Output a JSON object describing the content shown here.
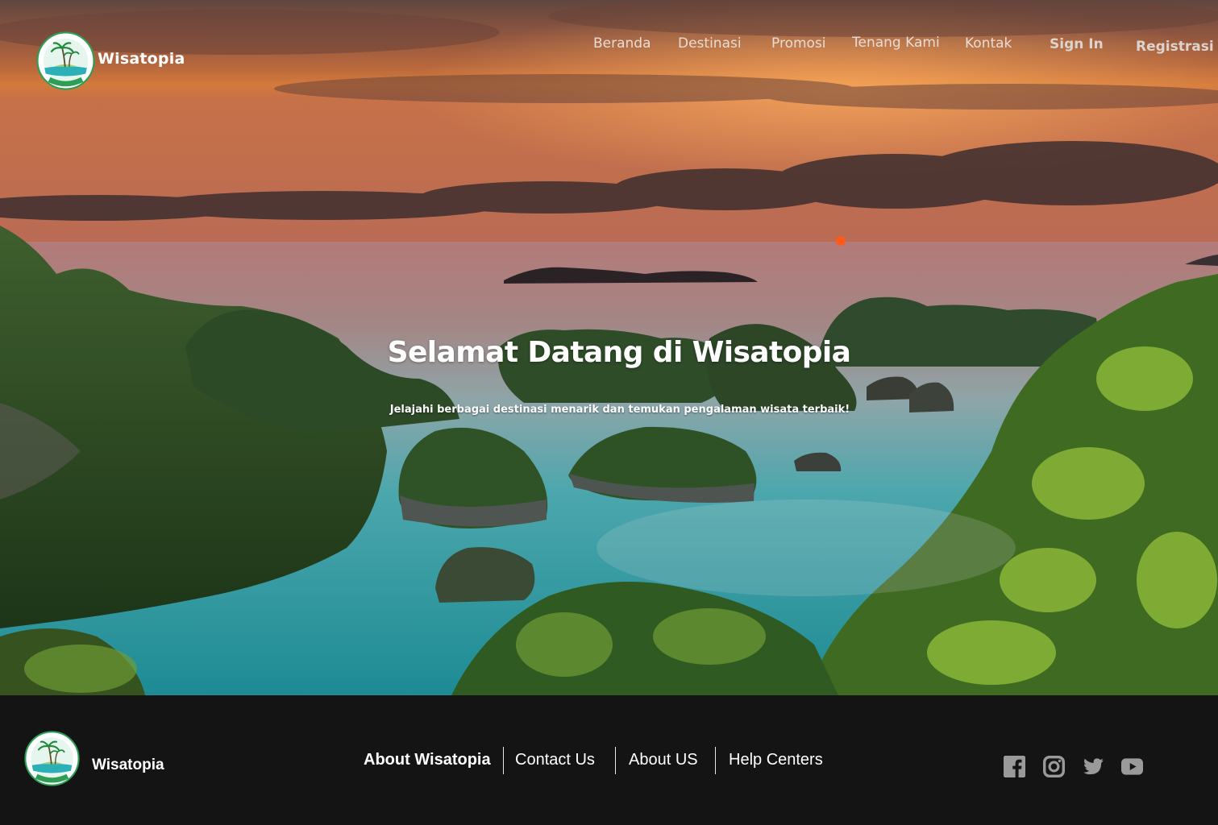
{
  "brand": {
    "name": "Wisatopia",
    "logo_ring_text": "Wisatopia",
    "logo_colors": {
      "ring": "#2e9e55",
      "sky": "#e6f6ee",
      "sea": "#2bb0b8",
      "palm": "#1f8a3c"
    }
  },
  "nav": {
    "items": [
      "Beranda",
      "Destinasi",
      "Promosi",
      "Tenang Kami",
      "Kontak"
    ],
    "sign_in": "Sign In",
    "register": "Registrasi"
  },
  "hero": {
    "title": "Selamat Datang di Wisatopia",
    "subtitle": "Jelajahi berbagai destinasi menarik dan temukan pengalaman wisata terbaik!"
  },
  "footer": {
    "brand_name": "Wisatopia",
    "links": [
      "About Wisatopia",
      "Contact Us",
      "About US",
      "Help Centers"
    ],
    "social_icons": [
      "facebook-icon",
      "instagram-icon",
      "twitter-icon",
      "youtube-icon"
    ],
    "background": "#141414",
    "icon_color": "#9a9a9a"
  }
}
